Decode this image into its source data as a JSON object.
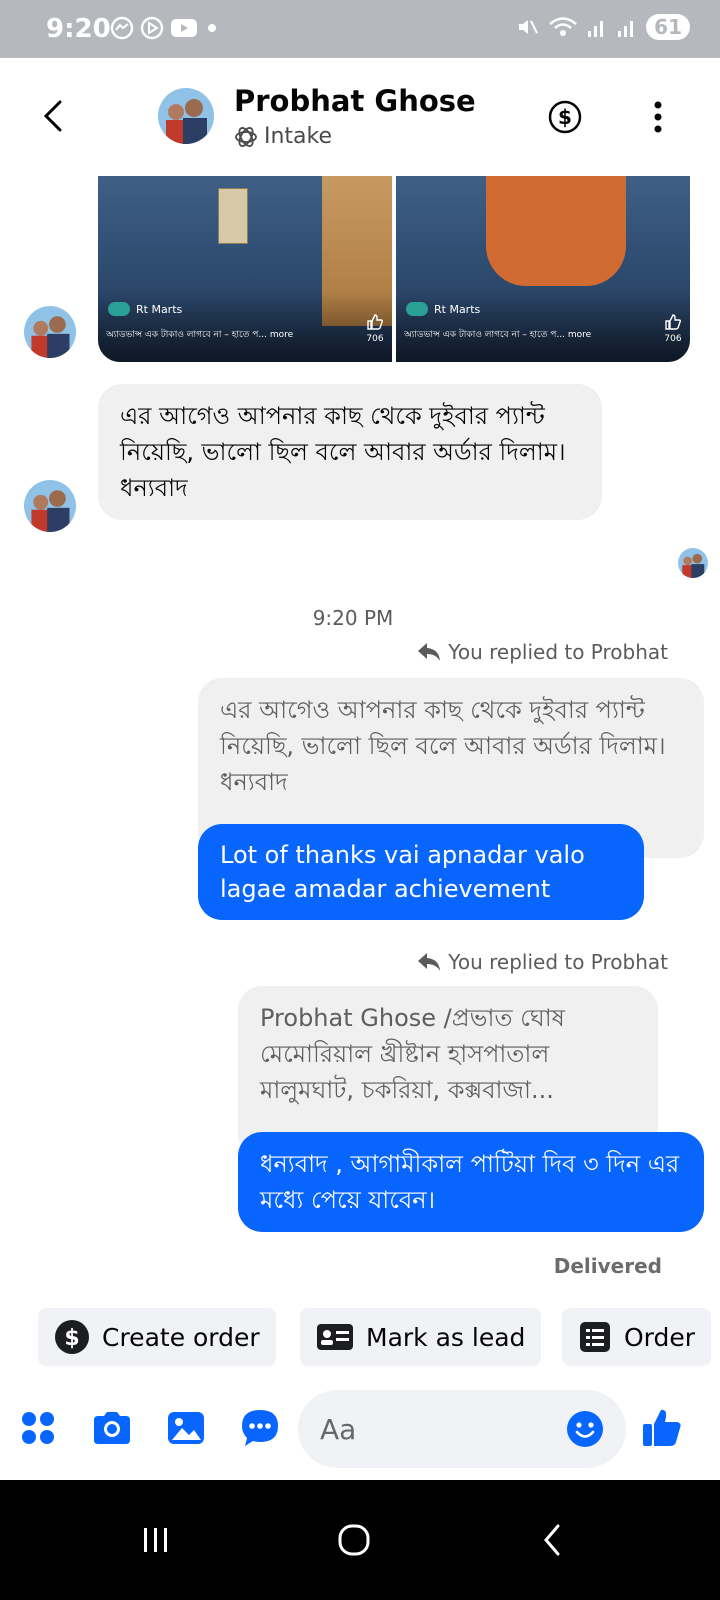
{
  "status_bar": {
    "time": "9:20",
    "battery": "61",
    "icons": [
      "messenger-icon",
      "play-icon",
      "youtube-icon",
      "dot-icon",
      "mute-icon",
      "wifi-icon",
      "signal-icon",
      "signal-icon",
      "battery-icon"
    ]
  },
  "header": {
    "name": "Probhat Ghose",
    "subtitle": "Intake",
    "icons": [
      "back-icon",
      "avatar",
      "intake-icon",
      "dollar-icon",
      "more-icon"
    ]
  },
  "shared_images": [
    {
      "brand": "Rt Marts",
      "caption": "অ্যাডভান্স এক টাকাও লাগবে না – হাতে প...",
      "more": "more",
      "likes": "706"
    },
    {
      "brand": "Rt Marts",
      "caption": "অ্যাডভান্স এক টাকাও লাগবে না – হাতে প...",
      "more": "more",
      "likes": "706"
    }
  ],
  "messages": {
    "incoming_1": "এর আগেও আপনার কাছ থেকে দুইবার প্যান্ট নিয়েছি, ভালো ছিল বলে আবার অর্ডার দিলাম। ধন্যবাদ",
    "timestamp": "9:20 PM",
    "reply_label_1": "You replied to Probhat",
    "quoted_1": "এর আগেও আপনার কাছ থেকে দুইবার প্যান্ট নিয়েছি, ভালো ছিল বলে আবার অর্ডার দিলাম। ধন্যবাদ",
    "outgoing_1": "Lot of thanks vai apnadar valo lagae amadar achievement",
    "reply_label_2": "You replied to Probhat",
    "quoted_2": "Probhat Ghose /প্রভাত ঘোষ মেমোরিয়াল খ্রীষ্টান হাসপাতাল মালুমঘাট, চকরিয়া, কক্সবাজা...",
    "outgoing_2": "ধন্যবাদ , আগামীকাল পাটিয়া দিব ৩ দিন এর মধ্যে পেয়ে যাবেন।",
    "delivered": "Delivered"
  },
  "quick_actions": [
    {
      "label": "Create order",
      "icon": "dollar-icon"
    },
    {
      "label": "Mark as lead",
      "icon": "contact-card-icon"
    },
    {
      "label": "Order",
      "icon": "order-list-icon"
    }
  ],
  "composer": {
    "placeholder": "Aa",
    "icons": [
      "apps-icon",
      "camera-icon",
      "gallery-icon",
      "chat-bubble-icon",
      "emoji-icon",
      "like-icon"
    ]
  },
  "colors": {
    "accent": "#0866ff",
    "bubble_in": "#f0f0f0",
    "status_bar": "#b5b8bd",
    "nav_bar": "#000000"
  }
}
